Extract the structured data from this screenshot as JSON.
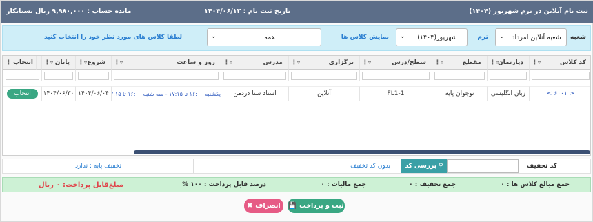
{
  "header": {
    "title": "ثبت نام آنلاین در ترم شهریور (۱۴۰۴)",
    "reg_date": "تاریخ ثبت نام : ۱۴۰۴/۰۶/۱۲",
    "balance": "مانده حساب : ۹,۹۸۰,۰۰۰ ریال بستانکار"
  },
  "filters": {
    "branch_label": "شعبه",
    "branch_value": "شعبه آنلاین امرداد",
    "term_label": "ترم",
    "term_value": "شهریور(۱۴۰۴)",
    "show_label": "نمایش کلاس ها",
    "show_value": "همه",
    "hint": "لطفا کلاس های مورد نظر خود را انتخاب کنید"
  },
  "table": {
    "columns": [
      "کد کلاس",
      "دپارتمان",
      "مقطع",
      "سطح/درس",
      "برگزاری",
      "مدرس",
      "روز و ساعت",
      "شروع",
      "پایان",
      "",
      "انتخاب"
    ],
    "row": {
      "code": "< ۶۰۰۱ >",
      "department": "زبان انگلیسی",
      "grade": "نوجوان پایه",
      "level": "FL1-1",
      "mode": "آنلاین",
      "teacher": "استاد سنا دردمن",
      "schedule": "یکشنبه ۱۶:۰۰ تا ۱۷:۱۵ - سه شنبه ۱۶:۰۰ تا ۱۷:۱۵",
      "start": "۱۴۰۴/۰۶/۰۴",
      "end": "۱۴۰۴/۰۶/۳۰",
      "select_btn": "انتخاب"
    }
  },
  "discount": {
    "label": "کد تخفیف",
    "check_btn": "بررسی کد",
    "status": "بدون کد تخفیف",
    "base": "تخفیف پایه : ندارد"
  },
  "summary": {
    "total": "جمع مبالغ کلاس ها : ۰",
    "discount": "جمع تخفیف : ۰",
    "tax": "جمع مالیات : ۰",
    "percent": "درصد قابل پرداخت : ۱۰۰ %",
    "payable": "مبلغ‌قابل پرداخت: ۰ ریال"
  },
  "actions": {
    "submit": "ثبت و پرداخت",
    "cancel": "انصراف"
  },
  "colors": {
    "header": "#5c6e89",
    "accent_blue": "#2b7fd1",
    "green": "#3aa783",
    "pink": "#e65b85",
    "payable_red": "#e0434a"
  }
}
